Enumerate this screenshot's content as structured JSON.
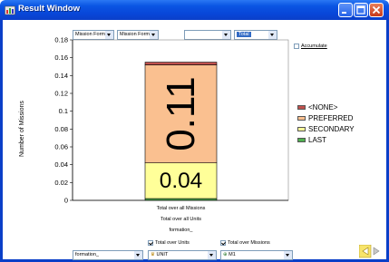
{
  "window": {
    "title": "Result Window"
  },
  "toolbar": {
    "filter1": "Mission Format",
    "filter2": "Mission Format",
    "filter3": "",
    "filter4": "Total",
    "accumulate_label": "Accumulate"
  },
  "bottom": {
    "cb_units_label": "Total over Units",
    "cb_missions_label": "Total over Missions",
    "select_formation": "formation_",
    "select_unit": "UNIT",
    "select_m1": "M1"
  },
  "colors": {
    "title_bar": "#0a55e3",
    "none": "#c0504d",
    "preferred": "#fac090",
    "secondary": "#ffff99",
    "last": "#4fb150"
  },
  "chart_data": {
    "type": "bar",
    "stacked": true,
    "ylabel": "Number of Missions",
    "ylim": [
      0,
      0.18
    ],
    "yticks": [
      0,
      0.02,
      0.04,
      0.06,
      0.08,
      0.1,
      0.12,
      0.14,
      0.16,
      0.18
    ],
    "ytick_labels": [
      "0",
      "0.02",
      "0.04",
      "0.06",
      "0.08",
      "0.1",
      "0.12",
      "0.14",
      "0.16",
      "0.18"
    ],
    "categories": [
      "Total over all Missions\nTotal over all Units\nformation_"
    ],
    "category_lines": [
      "Total over all Missions",
      "Total over all Units",
      "formation_"
    ],
    "series": [
      {
        "name": "LAST",
        "values": [
          0.002
        ],
        "color": "#4fb150"
      },
      {
        "name": "SECONDARY",
        "values": [
          0.04
        ],
        "color": "#ffff99",
        "label": "0.04"
      },
      {
        "name": "PREFERRED",
        "values": [
          0.11
        ],
        "color": "#fac090",
        "label": "0.11"
      },
      {
        "name": "<NONE>",
        "values": [
          0.003
        ],
        "color": "#c0504d"
      }
    ],
    "legend": [
      "<NONE>",
      "PREFERRED",
      "SECONDARY",
      "LAST"
    ],
    "legend_position": "right",
    "grid": false
  }
}
